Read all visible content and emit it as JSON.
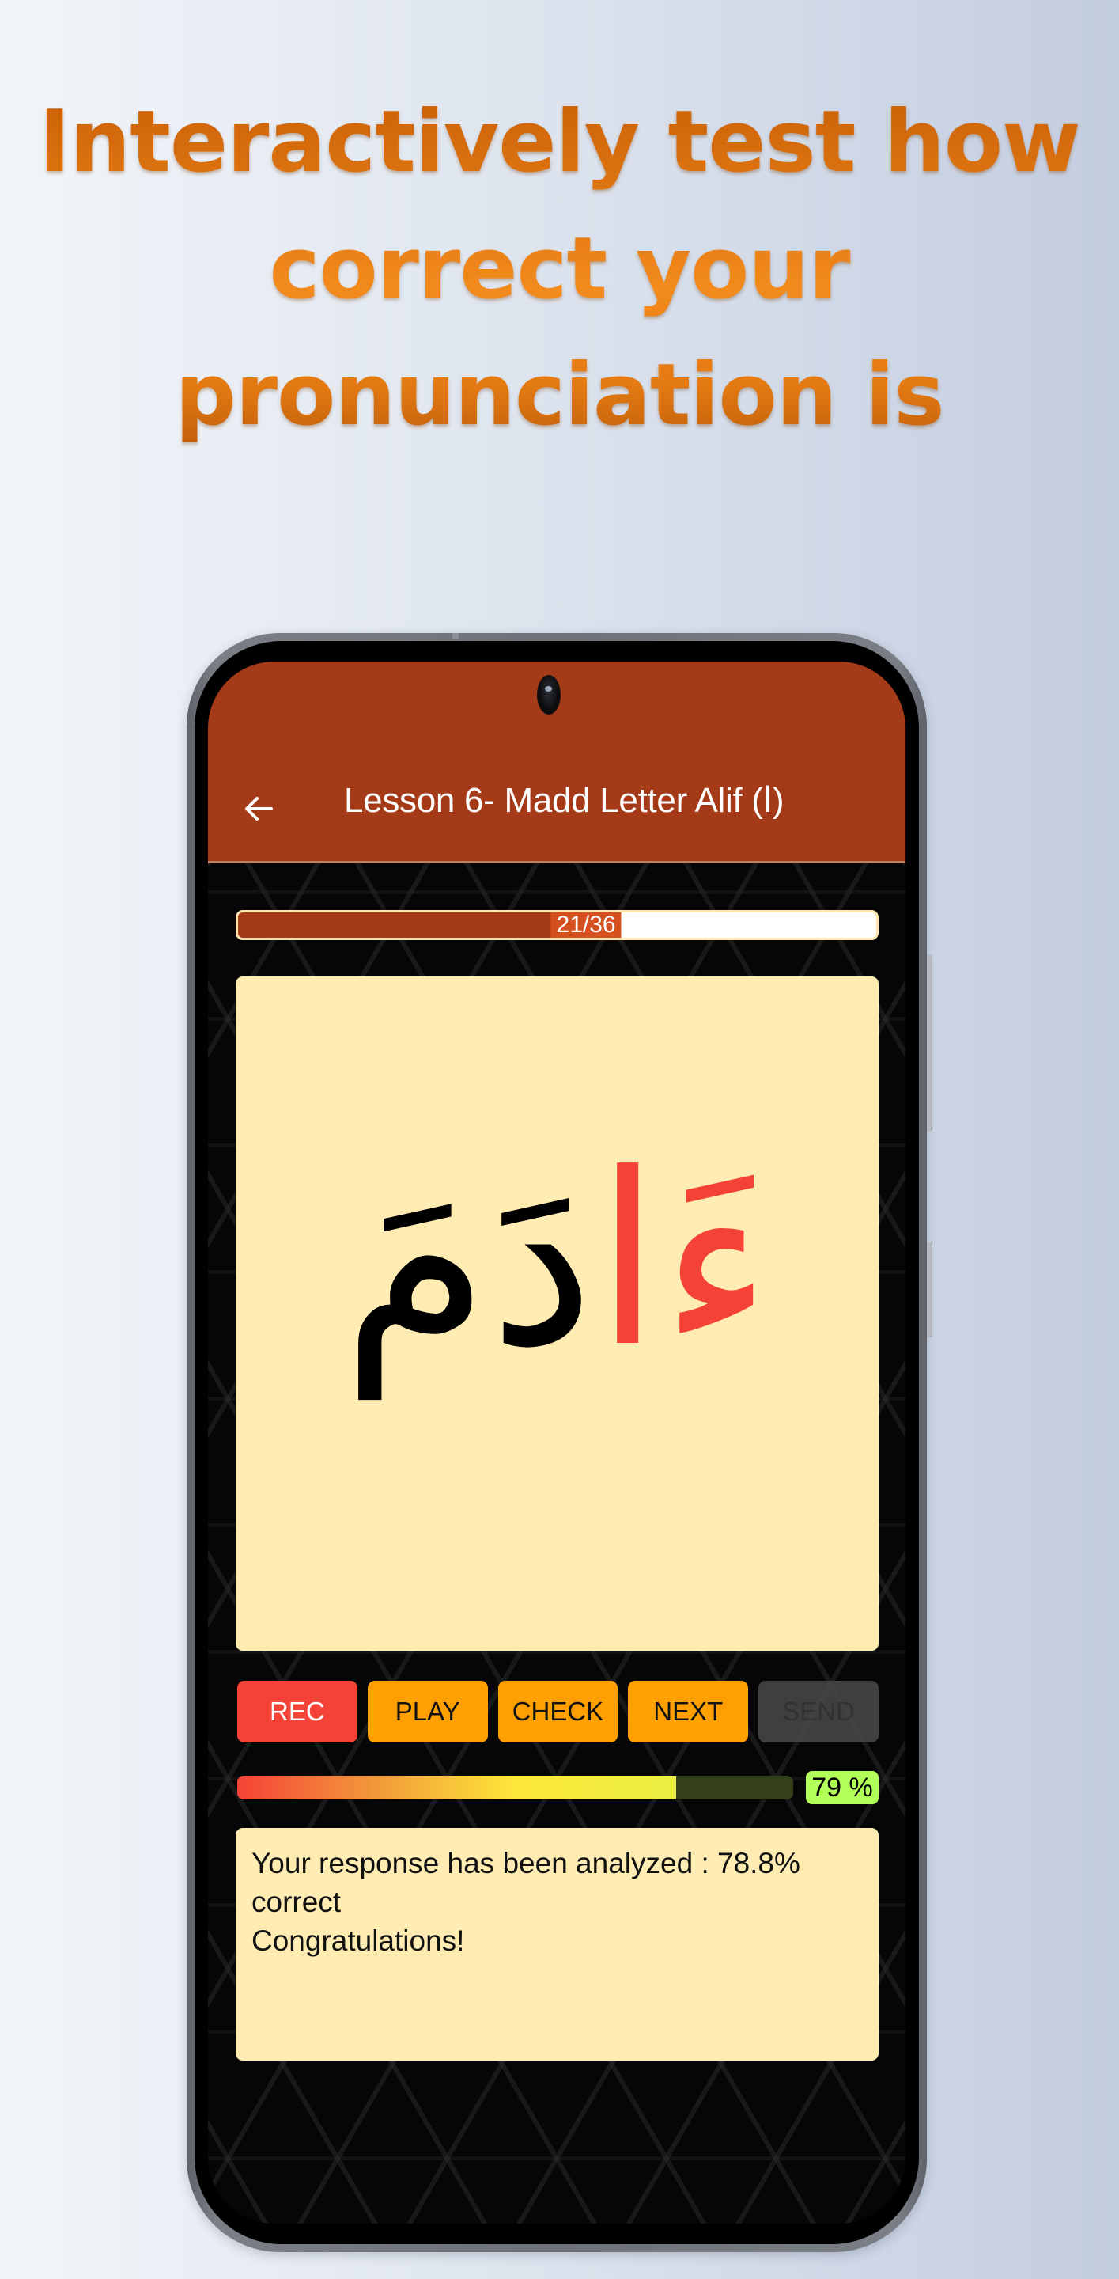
{
  "headline": {
    "lines": [
      "Interactively test how",
      "correct your",
      "pronunciation is"
    ]
  },
  "app": {
    "title": "Lesson 6- Madd Letter Alif (ا)",
    "back_icon": "arrow-left-icon",
    "colors": {
      "app_bar": "#a43a18",
      "card": "#ffecb3",
      "rec": "#f44336",
      "button": "#ffa000",
      "score_badge": "#b2ff59",
      "highlight_letter": "#f44336"
    }
  },
  "progress": {
    "current": 21,
    "total": 36,
    "label": "21/36"
  },
  "word": {
    "highlighted": "ءَا",
    "rest": "دَمَ",
    "full": "ءَادَمَ"
  },
  "buttons": [
    {
      "label": "REC",
      "enabled": true
    },
    {
      "label": "PLAY",
      "enabled": true
    },
    {
      "label": "CHECK",
      "enabled": true
    },
    {
      "label": "NEXT",
      "enabled": true
    },
    {
      "label": "SEND",
      "enabled": false
    }
  ],
  "score": {
    "percent": 79,
    "label": "79 %"
  },
  "feedback": {
    "line1": "Your response has been analyzed : 78.8% correct",
    "line2": "Congratulations!"
  }
}
